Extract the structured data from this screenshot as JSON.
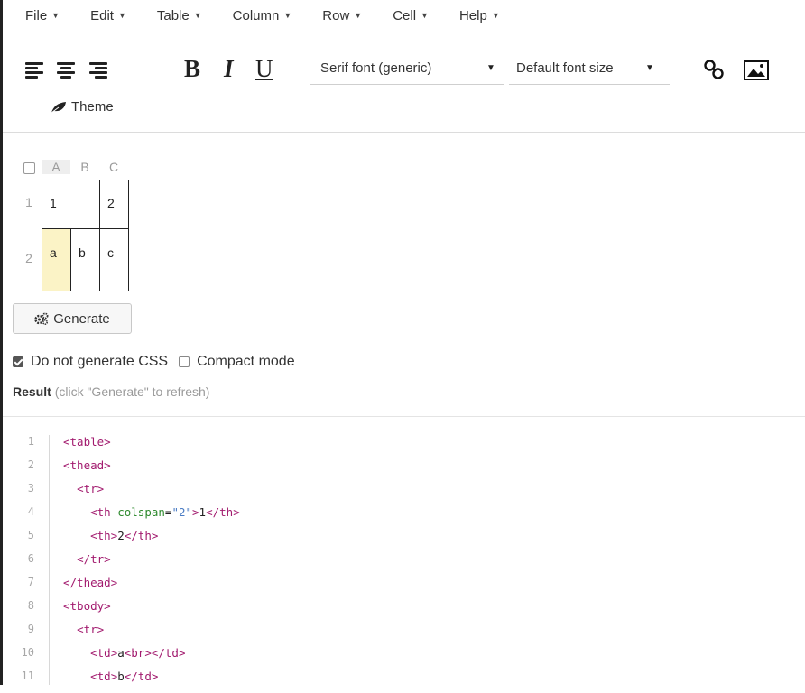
{
  "menu": [
    {
      "label": "File"
    },
    {
      "label": "Edit"
    },
    {
      "label": "Table"
    },
    {
      "label": "Column"
    },
    {
      "label": "Row"
    },
    {
      "label": "Cell"
    },
    {
      "label": "Help"
    }
  ],
  "toolbar": {
    "bold": "B",
    "italic": "I",
    "underline": "U",
    "font_family": "Serif font (generic)",
    "font_size": "Default font size",
    "theme": "Theme"
  },
  "table_editor": {
    "columns": [
      "A",
      "B",
      "C"
    ],
    "rows": [
      "1",
      "2"
    ],
    "cells": {
      "r1_merged_ab": "1",
      "r1_c": "2",
      "r2_a": "a",
      "r2_b": "b",
      "r2_c": "c"
    }
  },
  "generate_label": "Generate",
  "options": {
    "no_css_label": "Do not generate CSS",
    "no_css_checked": true,
    "compact_label": "Compact mode",
    "compact_checked": false
  },
  "result": {
    "label": "Result",
    "hint": "(click \"Generate\" to refresh)"
  },
  "code_lines": [
    {
      "n": "1",
      "text": "<table>"
    },
    {
      "n": "2",
      "text": "<thead>"
    },
    {
      "n": "3",
      "text": "  <tr>"
    },
    {
      "n": "4",
      "text": "    <th colspan=\"2\">1</th>"
    },
    {
      "n": "5",
      "text": "    <th>2</th>"
    },
    {
      "n": "6",
      "text": "  </tr>"
    },
    {
      "n": "7",
      "text": "</thead>"
    },
    {
      "n": "8",
      "text": "<tbody>"
    },
    {
      "n": "9",
      "text": "  <tr>"
    },
    {
      "n": "10",
      "text": "    <td>a<br></td>"
    },
    {
      "n": "11",
      "text": "    <td>b</td>"
    }
  ]
}
